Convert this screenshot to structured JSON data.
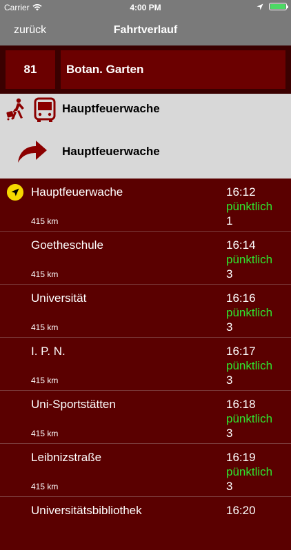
{
  "status_bar": {
    "carrier": "Carrier",
    "time": "4:00 PM",
    "battery_level": 1.0
  },
  "nav": {
    "back_label": "zurück",
    "title": "Fahrtverlauf"
  },
  "route": {
    "number": "81",
    "destination": "Botan. Garten"
  },
  "info": {
    "boarding_stop": "Hauptfeuerwache",
    "next_stop": "Hauptfeuerwache"
  },
  "stops": [
    {
      "name": "Hauptfeuerwache",
      "distance": "415 km",
      "time": "16:12",
      "status": "pünktlich",
      "platform": "1",
      "current": true
    },
    {
      "name": "Goetheschule",
      "distance": "415 km",
      "time": "16:14",
      "status": "pünktlich",
      "platform": "3",
      "current": false
    },
    {
      "name": "Universität",
      "distance": "415 km",
      "time": "16:16",
      "status": "pünktlich",
      "platform": "3",
      "current": false
    },
    {
      "name": "I. P. N.",
      "distance": "415 km",
      "time": "16:17",
      "status": "pünktlich",
      "platform": "3",
      "current": false
    },
    {
      "name": "Uni-Sportstätten",
      "distance": "415 km",
      "time": "16:18",
      "status": "pünktlich",
      "platform": "3",
      "current": false
    },
    {
      "name": "Leibnizstraße",
      "distance": "415 km",
      "time": "16:19",
      "status": "pünktlich",
      "platform": "3",
      "current": false
    },
    {
      "name": "Universitätsbibliothek",
      "distance": "",
      "time": "16:20",
      "status": "",
      "platform": "",
      "current": false
    }
  ],
  "colors": {
    "background": "#5a0000",
    "header_cell": "#6b0000",
    "status_ok": "#2ee62e",
    "location_icon": "#f5d800"
  },
  "icons": {
    "status": [
      "wifi-icon",
      "location-arrow-icon",
      "battery-icon"
    ],
    "info": [
      "walking-icon",
      "bus-icon",
      "turn-arrow-icon"
    ],
    "current_stop": "location-arrow-icon"
  }
}
